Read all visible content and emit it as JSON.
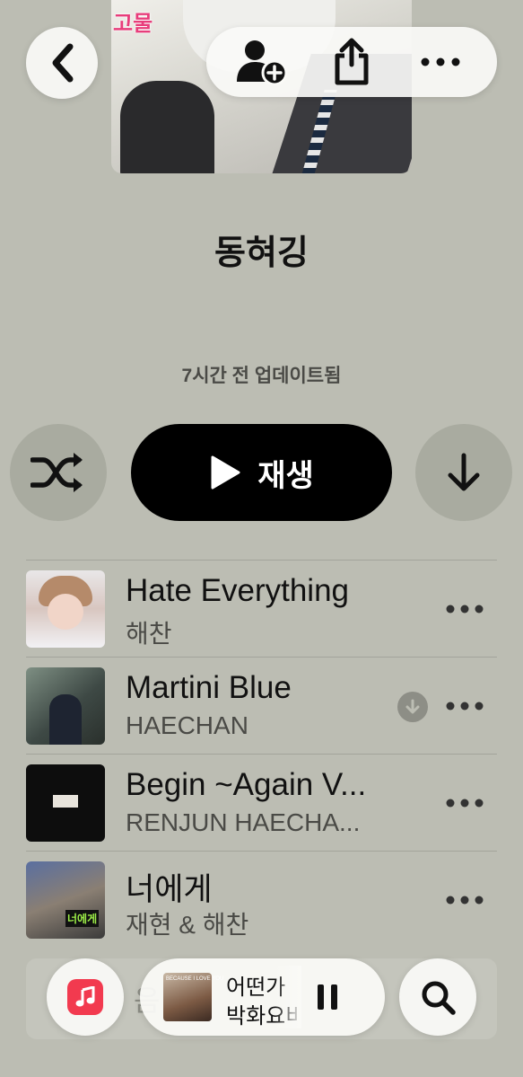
{
  "cover": {
    "caption": "고물"
  },
  "playlist": {
    "title": "동혀깅",
    "updated": "7시간 전 업데이트됨",
    "play_label": "재생"
  },
  "songs": [
    {
      "title": "Hate Everything",
      "artist": "해찬",
      "downloaded": false
    },
    {
      "title": "Martini Blue",
      "artist": "HAECHAN",
      "downloaded": true
    },
    {
      "title": "Begin ~Again V...",
      "artist": "RENJUN HAECHA...",
      "downloaded": false
    },
    {
      "title": "너에게",
      "artist": "재현 & 해찬",
      "downloaded": false,
      "art_tag": "너에게"
    }
  ],
  "partial_row_text": "음",
  "now_playing": {
    "title": "어떤가",
    "artist": "박화요비",
    "art_caption": "BECAUSE I LOVE YOU"
  },
  "icons": {
    "back": "chevron-left-icon",
    "add_user": "person-add-icon",
    "share": "share-icon",
    "more": "ellipsis-icon",
    "shuffle": "shuffle-icon",
    "play": "play-icon",
    "download": "download-arrow-icon",
    "music_app": "music-note-icon",
    "pause": "pause-icon",
    "search": "magnifier-icon"
  },
  "colors": {
    "background": "#bcbdb3",
    "accent": "#f23a4f",
    "play_button": "#000000"
  }
}
